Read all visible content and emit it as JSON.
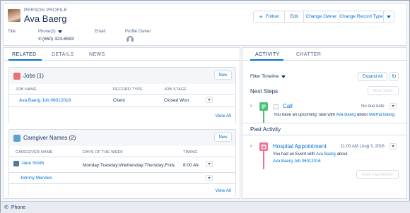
{
  "header": {
    "record_type": "PERSON PROFILE",
    "record_name": "Ava Baerg",
    "buttons": {
      "follow": "Follow",
      "edit": "Edit",
      "change_owner": "Change Owner",
      "change_record_type": "Change Record Type"
    },
    "fields": {
      "title_label": "Title",
      "phone_label": "Phone(2)",
      "phone_value": "(650) 323-6593",
      "email_label": "Email",
      "owner_label": "Profile Owner"
    }
  },
  "left_tabs": [
    "RELATED",
    "DETAILS",
    "NEWS"
  ],
  "jobs": {
    "title": "Jobs (1)",
    "new_label": "New",
    "columns": [
      "JOB NAME",
      "RECORD TYPE",
      "JOB STAGE"
    ],
    "rows": [
      {
        "name": "Ava Baerg Job 06012016",
        "record_type": "Client",
        "stage": "Closed Won"
      }
    ],
    "view_all": "View All"
  },
  "caregivers": {
    "title": "Caregiver Names (2)",
    "new_label": "New",
    "columns": [
      "CAREGIVER NAME",
      "DAYS OF THE WEEK",
      "TIMING"
    ],
    "rows": [
      {
        "name": "Jane Smith",
        "days": "Monday;Tuesday;Wednesday;Thursday;Friday",
        "timing": "8:00 AM"
      },
      {
        "name": "Johnny Mendes",
        "days": "",
        "timing": ""
      }
    ],
    "view_all": "View All"
  },
  "right_tabs": [
    "ACTIVITY",
    "CHATTER"
  ],
  "activity": {
    "filter_label": "Filter Timeline",
    "expand_all": "Expand All",
    "next_steps_title": "Next Steps",
    "more_steps": "More Steps",
    "task": {
      "title": "Call",
      "due": "No due date",
      "text_prefix": "You have an upcoming Task with",
      "who": "Ava Baerg",
      "about": "about",
      "what": "Martha Baerg"
    },
    "past_title": "Past Activity",
    "event": {
      "title": "Hospital Appointment",
      "date": "11:00 AM | Aug 3, 2016",
      "text_prefix": "You had an Event with",
      "who": "Ava Baerg",
      "about": "about",
      "what": "Ava Baerg Job 06012016"
    },
    "more_past": "More Past Activity"
  },
  "bottom": {
    "phone_label": "Phone"
  },
  "colors": {
    "accent": "#0070d2",
    "jobs_icon": "#e8727a",
    "caregiver_icon": "#5ba0d6",
    "task_icon": "#4bc076",
    "event_icon": "#eb7092"
  }
}
